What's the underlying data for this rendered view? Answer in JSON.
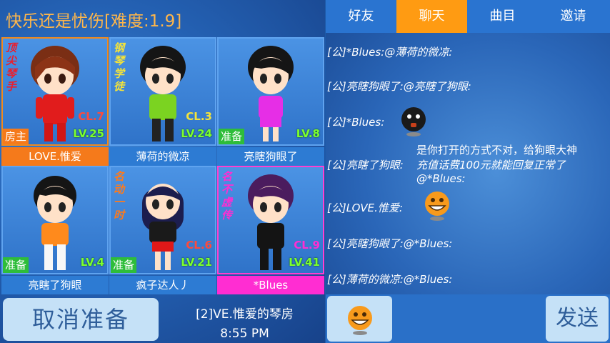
{
  "room": {
    "title": "快乐还是忧伤[难度:1.9]",
    "players": [
      {
        "name": "LOVE.惟爱",
        "title": "顶尖琴手",
        "cl": "CL.7",
        "lv": "LV.25",
        "badge": "房主"
      },
      {
        "name": "薄荷的微凉",
        "title": "钢琴学徒",
        "cl": "CL.3",
        "lv": "LV.24",
        "badge": ""
      },
      {
        "name": "亮瞎狗眼了",
        "title": "",
        "cl": "",
        "lv": "LV.8",
        "badge": "准备"
      },
      {
        "name": "亮瞎了狗眼",
        "title": "",
        "cl": "",
        "lv": "LV.4",
        "badge": "准备"
      },
      {
        "name": "疯子达人丿",
        "title": "名动一时",
        "cl": "CL.6",
        "lv": "LV.21",
        "badge": "准备"
      },
      {
        "name": "*Blues",
        "title": "名不虚传",
        "cl": "CL.9",
        "lv": "LV.41",
        "badge": ""
      }
    ],
    "cancel_ready_label": "取消准备",
    "room_name": "[2]VE.惟爱的琴房",
    "clock": "8:55 PM"
  },
  "tabs": [
    "好友",
    "聊天",
    "曲目",
    "邀请"
  ],
  "active_tab": "聊天",
  "chat": {
    "messages": [
      {
        "text": "[公]*Blues:@薄荷的微凉:"
      },
      {
        "text": "[公]亮瞎狗眼了:@亮瞎了狗眼:"
      },
      {
        "text": "[公]*Blues:",
        "sticker": "black-bomb-face"
      },
      {
        "text": "[公]亮瞎了狗眼:",
        "reply_lines": [
          "是你打开的方式不对，给狗眼大神",
          "充值话费100元就能回复正常了",
          "@*Blues:"
        ]
      },
      {
        "text": "[公]LOVE.惟爱:",
        "sticker": "orange-grin-face"
      },
      {
        "text": "[公]亮瞎狗眼了:@*Blues:"
      },
      {
        "text": "[公]薄荷的微凉:@*Blues:"
      }
    ]
  },
  "input": {
    "emoji_icon": "orange-grin-face",
    "send_label": "发送"
  },
  "colors": {
    "accent": "#ff9b12",
    "ready": "#2ebd3a",
    "host": "#f57a1b",
    "level": "#7cff2e",
    "pink": "#ff2dd2",
    "button": "#c5e1f7"
  }
}
